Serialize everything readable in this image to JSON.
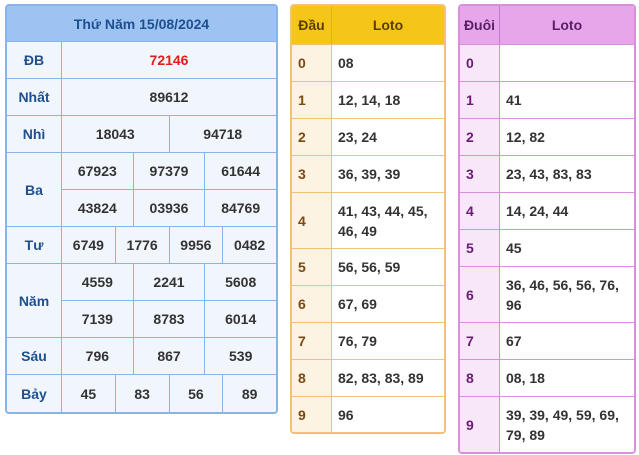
{
  "results": {
    "title": "Thứ Năm 15/08/2024",
    "prizes": [
      {
        "label": "ĐB",
        "lines": [
          [
            "72146"
          ]
        ],
        "highlight": true
      },
      {
        "label": "Nhất",
        "lines": [
          [
            "89612"
          ]
        ]
      },
      {
        "label": "Nhì",
        "lines": [
          [
            "18043",
            "94718"
          ]
        ]
      },
      {
        "label": "Ba",
        "lines": [
          [
            "67923",
            "97379",
            "61644"
          ],
          [
            "43824",
            "03936",
            "84769"
          ]
        ]
      },
      {
        "label": "Tư",
        "lines": [
          [
            "6749",
            "1776",
            "9956",
            "0482"
          ]
        ]
      },
      {
        "label": "Năm",
        "lines": [
          [
            "4559",
            "2241",
            "5608"
          ],
          [
            "7139",
            "8783",
            "6014"
          ]
        ]
      },
      {
        "label": "Sáu",
        "lines": [
          [
            "796",
            "867",
            "539"
          ]
        ]
      },
      {
        "label": "Bảy",
        "lines": [
          [
            "45",
            "83",
            "56",
            "89"
          ]
        ]
      }
    ]
  },
  "dau": {
    "head_key": "Đầu",
    "head_val": "Loto",
    "rows": [
      {
        "key": "0",
        "val": "08"
      },
      {
        "key": "1",
        "val": "12, 14, 18"
      },
      {
        "key": "2",
        "val": "23, 24"
      },
      {
        "key": "3",
        "val": "36, 39, 39"
      },
      {
        "key": "4",
        "val": "41, 43, 44, 45, 46, 49"
      },
      {
        "key": "5",
        "val": "56, 56, 59"
      },
      {
        "key": "6",
        "val": "67, 69"
      },
      {
        "key": "7",
        "val": "76, 79"
      },
      {
        "key": "8",
        "val": "82, 83, 83, 89"
      },
      {
        "key": "9",
        "val": "96"
      }
    ]
  },
  "duoi": {
    "head_key": "Đuôi",
    "head_val": "Loto",
    "rows": [
      {
        "key": "0",
        "val": ""
      },
      {
        "key": "1",
        "val": "41"
      },
      {
        "key": "2",
        "val": "12, 82"
      },
      {
        "key": "3",
        "val": "23, 43, 83, 83"
      },
      {
        "key": "4",
        "val": "14, 24, 44"
      },
      {
        "key": "5",
        "val": "45"
      },
      {
        "key": "6",
        "val": "36, 46, 56, 56, 76, 96"
      },
      {
        "key": "7",
        "val": "67"
      },
      {
        "key": "8",
        "val": "08, 18"
      },
      {
        "key": "9",
        "val": "39, 39, 49, 59, 69, 79, 89"
      }
    ]
  }
}
